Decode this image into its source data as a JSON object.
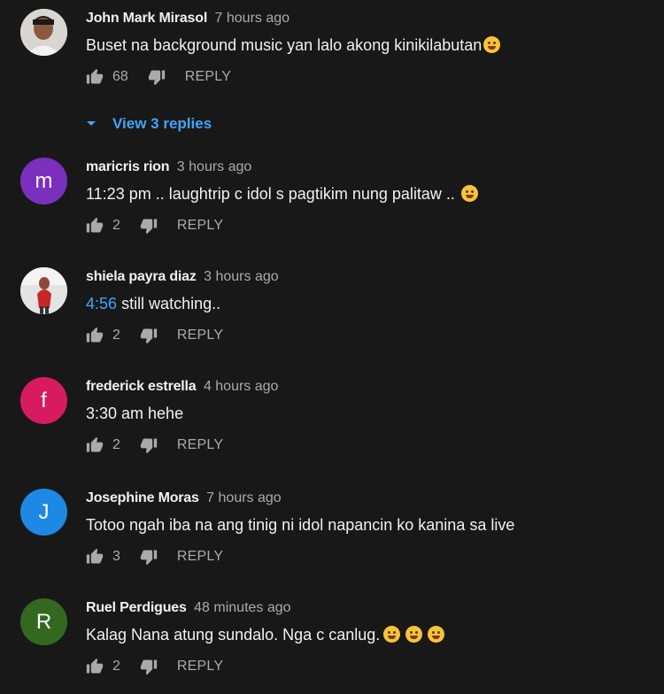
{
  "comments": [
    {
      "author": "John Mark Mirasol",
      "time": "7 hours ago",
      "text": "Buset na background music yan lalo akong kinikilabutan",
      "emoji": "laughing-tears",
      "likes": "68",
      "reply_label": "REPLY",
      "avatar_type": "photo",
      "view_replies": "View 3 replies"
    },
    {
      "author": "maricris rion",
      "time": "3 hours ago",
      "text": "11:23 pm .. laughtrip c idol s pagtikim nung palitaw ..",
      "emoji": "grinning-squint",
      "likes": "2",
      "reply_label": "REPLY",
      "avatar_letter": "m",
      "avatar_color": "#7b2fbe"
    },
    {
      "author": "shiela payra diaz",
      "time": "3 hours ago",
      "timestamp_link": "4:56",
      "text": "still watching..",
      "likes": "2",
      "reply_label": "REPLY",
      "avatar_type": "photo"
    },
    {
      "author": "frederick estrella",
      "time": "4 hours ago",
      "text": "3:30 am hehe",
      "likes": "2",
      "reply_label": "REPLY",
      "avatar_letter": "f",
      "avatar_color": "#d81b60"
    },
    {
      "author": "Josephine Moras",
      "time": "7 hours ago",
      "text": "Totoo ngah iba na ang tinig ni idol napancin ko kanina sa live",
      "likes": "3",
      "reply_label": "REPLY",
      "avatar_letter": "J",
      "avatar_color": "#1e88e5"
    },
    {
      "author": "Ruel Perdigues",
      "time": "48 minutes ago",
      "text": "Kalag Nana atung sundalo. Nga c canlug.",
      "emoji": "rolling-laughing x3",
      "likes": "2",
      "reply_label": "REPLY",
      "avatar_letter": "R",
      "avatar_color": "#33691e"
    }
  ],
  "colors": {
    "background": "#181818",
    "text": "#f1f1f1",
    "secondary": "#aaaaaa",
    "link": "#3ea6ff"
  }
}
